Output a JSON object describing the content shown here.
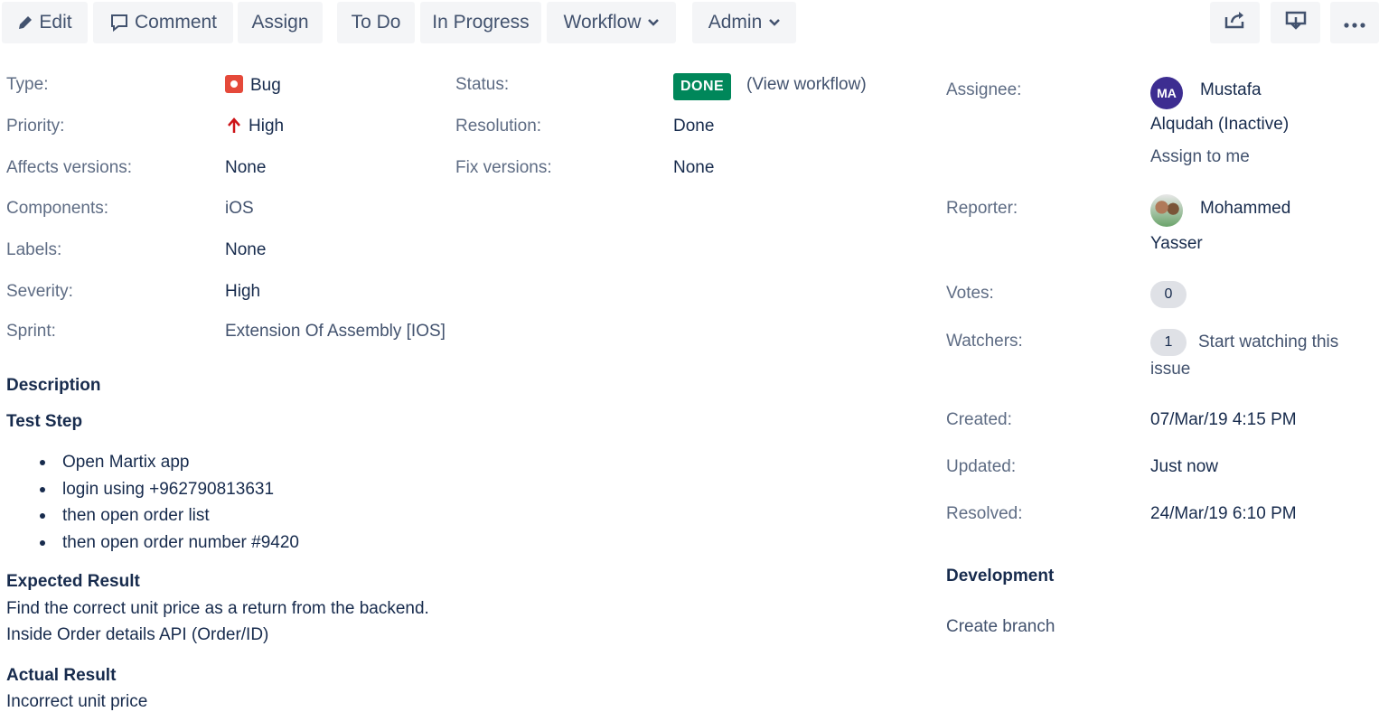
{
  "toolbar": {
    "edit": "Edit",
    "comment": "Comment",
    "assign": "Assign",
    "todo": "To Do",
    "in_progress": "In Progress",
    "workflow": "Workflow",
    "admin": "Admin"
  },
  "details": {
    "type_label": "Type:",
    "type_value": "Bug",
    "priority_label": "Priority:",
    "priority_value": "High",
    "affects_label": "Affects versions:",
    "affects_value": "None",
    "components_label": "Components:",
    "components_value": "iOS",
    "labels_label": "Labels:",
    "labels_value": "None",
    "severity_label": "Severity:",
    "severity_value": "High",
    "sprint_label": "Sprint:",
    "sprint_value": "Extension Of Assembly [IOS]",
    "status_label": "Status:",
    "status_value": "DONE",
    "view_workflow": "(View workflow)",
    "resolution_label": "Resolution:",
    "resolution_value": "Done",
    "fix_label": "Fix versions:",
    "fix_value": "None"
  },
  "description": {
    "heading": "Description",
    "test_step_heading": "Test Step",
    "steps": [
      "Open Martix app",
      "login using +962790813631",
      "then open order list",
      "then open order number #9420"
    ],
    "expected_heading": "Expected Result",
    "expected_line1": "Find the correct unit price as a return from the backend.",
    "expected_line2": "Inside Order details API (Order/ID)",
    "actual_heading": "Actual Result",
    "actual_line1": "Incorrect unit price"
  },
  "people": {
    "assignee_label": "Assignee:",
    "assignee_initials": "MA",
    "assignee_name_line1": "Mustafa",
    "assignee_name_line2": "Alqudah (Inactive)",
    "assign_to_me": "Assign to me",
    "reporter_label": "Reporter:",
    "reporter_name_line1": "Mohammed",
    "reporter_name_line2": "Yasser",
    "votes_label": "Votes:",
    "votes_count": "0",
    "watchers_label": "Watchers:",
    "watchers_count": "1",
    "watch_line1": "Start watching this",
    "watch_line2": "issue"
  },
  "dates": {
    "created_label": "Created:",
    "created_value": "07/Mar/19 4:15 PM",
    "updated_label": "Updated:",
    "updated_value": "Just now",
    "resolved_label": "Resolved:",
    "resolved_value": "24/Mar/19 6:10 PM"
  },
  "development": {
    "heading": "Development",
    "create_branch": "Create branch"
  },
  "colors": {
    "done_lozenge": "#00875a",
    "bug_icon": "#e5493a",
    "priority_high": "#cd1317",
    "assignee_avatar": "#3d2d91"
  },
  "icons": [
    "pencil-icon",
    "comment-icon",
    "chevron-down-icon",
    "share-icon",
    "export-icon",
    "more-icon",
    "bug-icon",
    "arrow-up-icon"
  ]
}
